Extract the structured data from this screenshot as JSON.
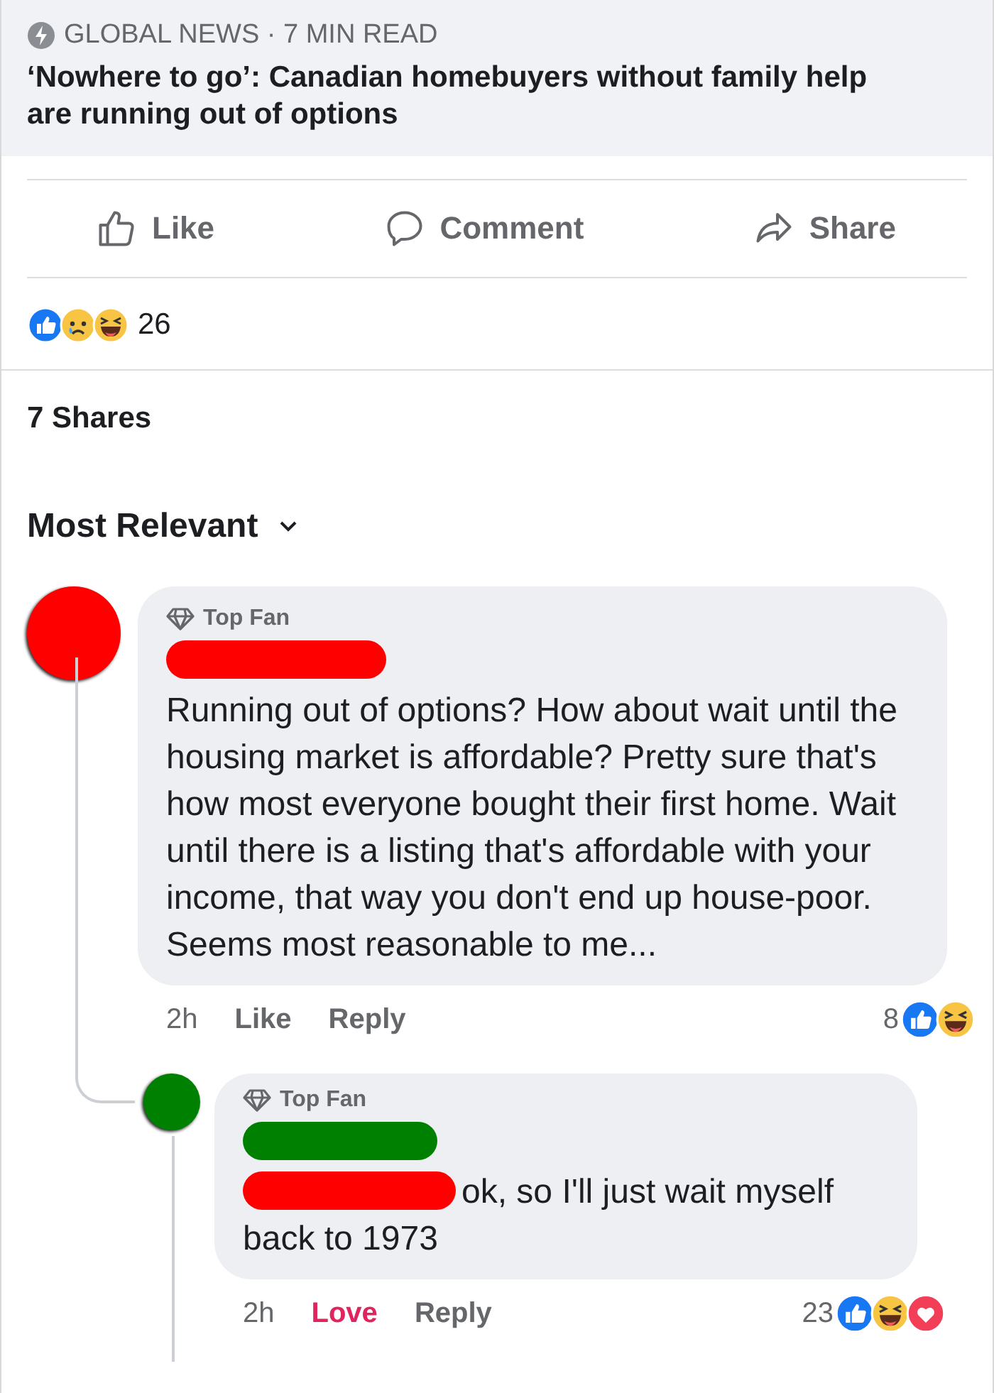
{
  "article": {
    "source": "GLOBAL NEWS · 7 MIN READ",
    "title": "‘Nowhere to go’: Canadian homebuyers without family help are running out of options"
  },
  "actions": [
    {
      "kind": "like",
      "label": "Like"
    },
    {
      "kind": "comment",
      "label": "Comment"
    },
    {
      "kind": "share",
      "label": "Share"
    }
  ],
  "reactions": {
    "icons": [
      {
        "kind": "like"
      },
      {
        "kind": "sad"
      },
      {
        "kind": "haha"
      }
    ],
    "count": "26"
  },
  "shares": "7 Shares",
  "sort": {
    "label": "Most Relevant"
  },
  "comments": [
    {
      "color": "#ff0000",
      "badge": "Top Fan",
      "text": "Running out of options? How about wait until the housing market is affordable? Pretty sure that's how most everyone bought their first home. Wait until there is a listing that's affordable with your income, that way you don't end up house-poor. Seems most reasonable to me...",
      "time": "2h",
      "reaction": {
        "label": "Like",
        "selected": false
      },
      "reply": "Reply",
      "reaction_count": "8",
      "reaction_icons": [
        {
          "kind": "like"
        },
        {
          "kind": "haha"
        }
      ],
      "replies": [
        {
          "color": "#008000",
          "badge": "Top Fan",
          "mention": {
            "color": "#ff0000"
          },
          "text": "ok, so I'll just wait myself back to 1973",
          "time": "2h",
          "reaction": {
            "label": "Love",
            "selected": true
          },
          "reply": "Reply",
          "reaction_count": "23",
          "reaction_icons": [
            {
              "kind": "like"
            },
            {
              "kind": "haha"
            },
            {
              "kind": "love"
            }
          ]
        }
      ]
    }
  ]
}
